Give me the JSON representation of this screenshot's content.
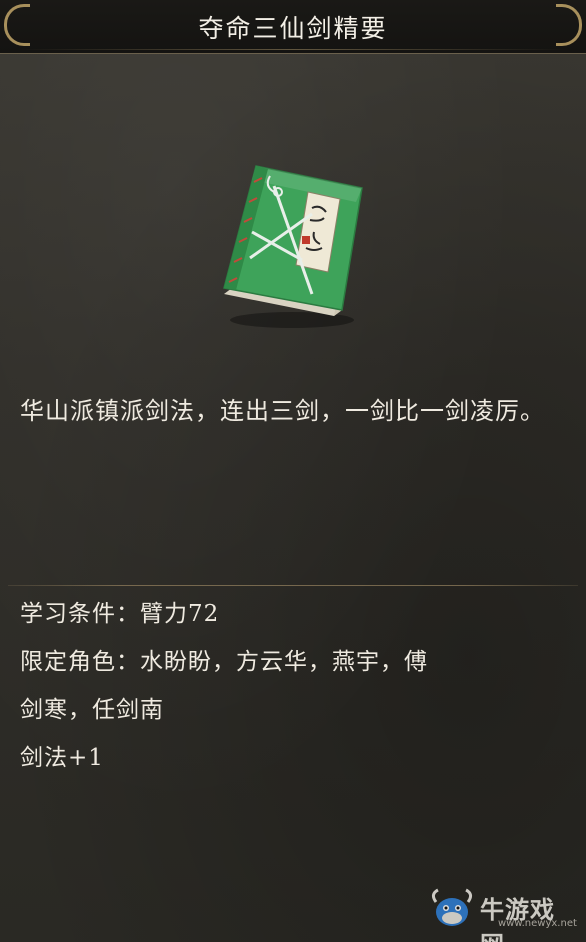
{
  "item": {
    "title": "夺命三仙剑精要",
    "icon": "green-martial-arts-book-icon",
    "description": "华山派镇派剑法，连出三剑，一剑比一剑凌厉。"
  },
  "requirements": {
    "learn_condition": "学习条件：臂力72",
    "limited_roles_line1": "限定角色：水盼盼，方云华，燕宇，傅",
    "limited_roles_line2": "剑寒，任剑南",
    "bonus": "剑法+1"
  },
  "watermark": {
    "logo_text": "牛游戏网",
    "url": "www.newyx.net"
  },
  "colors": {
    "book_cover": "#3ea35a",
    "frame_gold": "#a8905c",
    "text": "#efeae0"
  }
}
